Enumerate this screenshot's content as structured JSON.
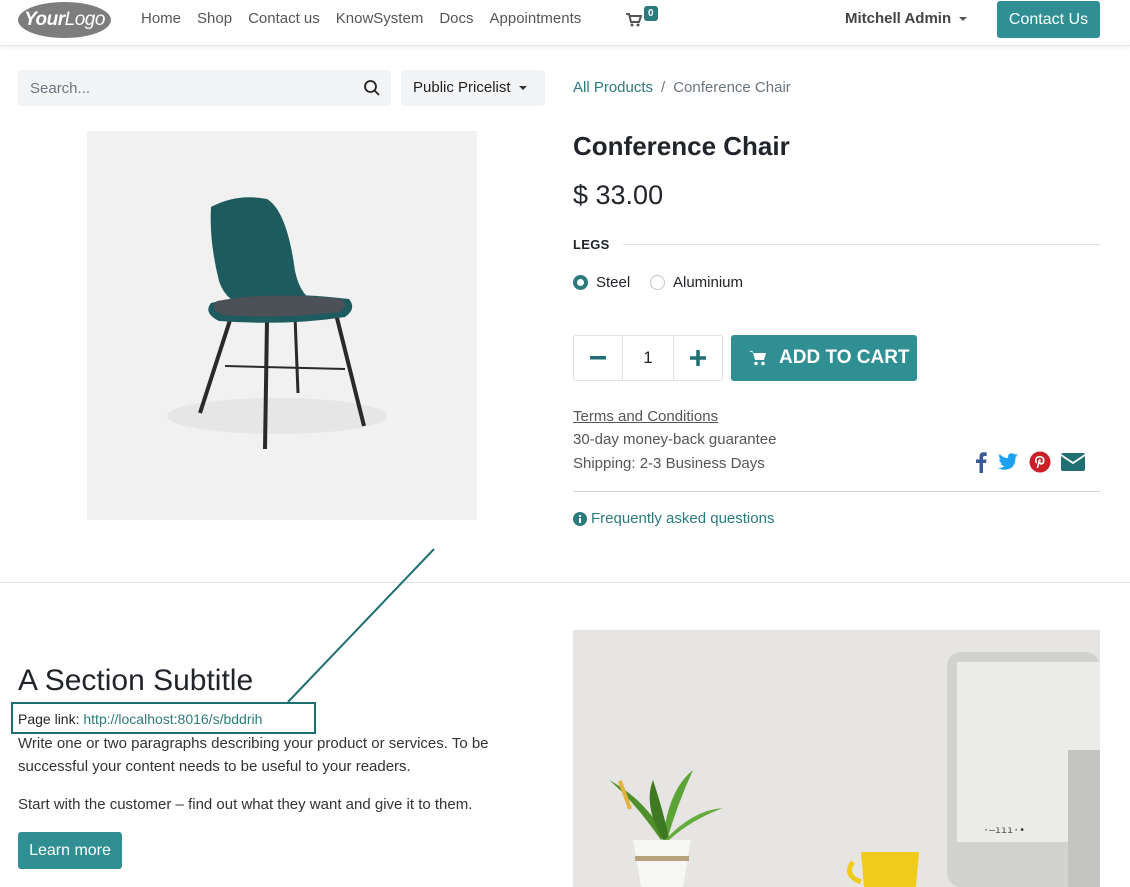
{
  "header": {
    "logo_bold": "Your",
    "logo_light": "Logo",
    "nav": [
      "Home",
      "Shop",
      "Contact us",
      "KnowSystem",
      "Docs",
      "Appointments"
    ],
    "cart_count": "0",
    "user": "Mitchell Admin",
    "contact_button": "Contact Us"
  },
  "search": {
    "placeholder": "Search..."
  },
  "pricelist": "Public Pricelist",
  "breadcrumb": {
    "parent": "All Products",
    "separator": "/",
    "current": "Conference Chair"
  },
  "product": {
    "title": "Conference Chair",
    "price": "$ 33.00",
    "attribute_label": "LEGS",
    "variants": [
      {
        "label": "Steel",
        "selected": true
      },
      {
        "label": "Aluminium",
        "selected": false
      }
    ],
    "quantity": "1",
    "add_to_cart": "ADD TO CART",
    "terms": "Terms and Conditions",
    "guarantee": "30-day money-back guarantee",
    "shipping": "Shipping: 2-3 Business Days",
    "faq": "Frequently asked questions"
  },
  "share_icons": [
    "facebook-icon",
    "twitter-icon",
    "pinterest-icon",
    "email-icon"
  ],
  "colors": {
    "primary": "#2f8f93",
    "link": "#2b7a7d",
    "facebook": "#3b5998",
    "twitter": "#1da1f2",
    "pinterest": "#cb2027",
    "email": "#1f6f73"
  },
  "section": {
    "subtitle": "A Section Subtitle",
    "page_link_label": "Page link:",
    "page_link_url": "http://localhost:8016/s/bddrih",
    "paragraph1": "Write one or two paragraphs describing your product or services. To be successful your content needs to be useful to your readers.",
    "paragraph2": "Start with the customer – find out what they want and give it to them.",
    "learn_more": "Learn more"
  }
}
